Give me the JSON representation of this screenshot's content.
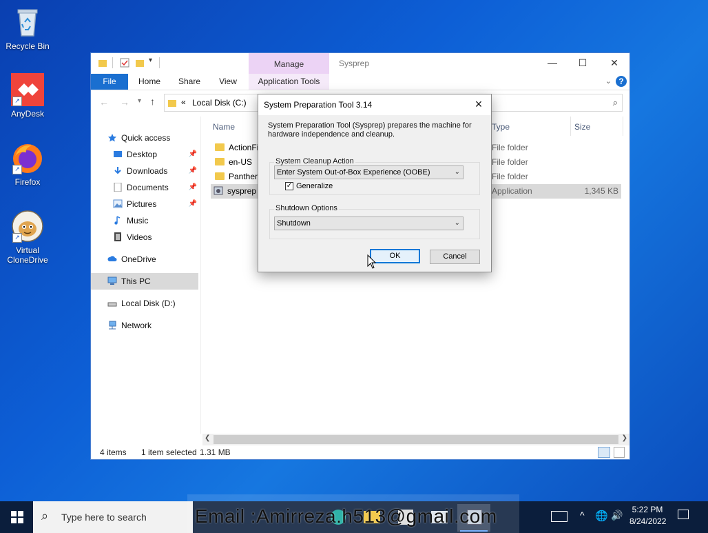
{
  "desktop": {
    "icons": [
      {
        "label": "Recycle Bin"
      },
      {
        "label": "AnyDesk"
      },
      {
        "label": "Firefox"
      },
      {
        "label": "Virtual CloneDrive"
      }
    ]
  },
  "explorer": {
    "title": "Sysprep",
    "context_tab": "Manage",
    "ribbon_tabs": [
      "File",
      "Home",
      "Share",
      "View",
      "Application Tools"
    ],
    "address": {
      "chevron": "«",
      "location": "Local Disk (C:)"
    },
    "nav": {
      "quick_access": "Quick access",
      "pinned": [
        "Desktop",
        "Downloads",
        "Documents",
        "Pictures"
      ],
      "unpinned": [
        "Music",
        "Videos"
      ],
      "onedrive": "OneDrive",
      "this_pc": "This PC",
      "local_disk": "Local Disk (D:)",
      "network": "Network"
    },
    "columns": {
      "name": "Name",
      "type": "Type",
      "size": "Size"
    },
    "files": [
      {
        "name": "ActionFi",
        "type": "File folder",
        "size": ""
      },
      {
        "name": "en-US",
        "type": "File folder",
        "size": ""
      },
      {
        "name": "Panther",
        "type": "File folder",
        "size": ""
      },
      {
        "name": "sysprep",
        "type": "Application",
        "size": "1,345 KB"
      }
    ],
    "status": {
      "items": "4 items",
      "selected": "1 item selected",
      "size": "1.31 MB"
    }
  },
  "dialog": {
    "title": "System Preparation Tool 3.14",
    "description": "System Preparation Tool (Sysprep) prepares the machine for hardware independence and cleanup.",
    "cleanup_label": "System Cleanup Action",
    "cleanup_value": "Enter System Out-of-Box Experience (OOBE)",
    "generalize_label": "Generalize",
    "generalize_checked": true,
    "shutdown_label": "Shutdown Options",
    "shutdown_value": "Shutdown",
    "ok_label": "OK",
    "cancel_label": "Cancel"
  },
  "taskbar": {
    "search_placeholder": "Type here to search",
    "time": "5:22 PM",
    "date": "8/24/2022"
  },
  "overlay": {
    "text": "Email :Amirreza.h513@gmail.com"
  },
  "colors": {
    "accent": "#1a6fd0",
    "manage_tab": "#ecd3f5",
    "taskbar": "#0b1e3c"
  }
}
